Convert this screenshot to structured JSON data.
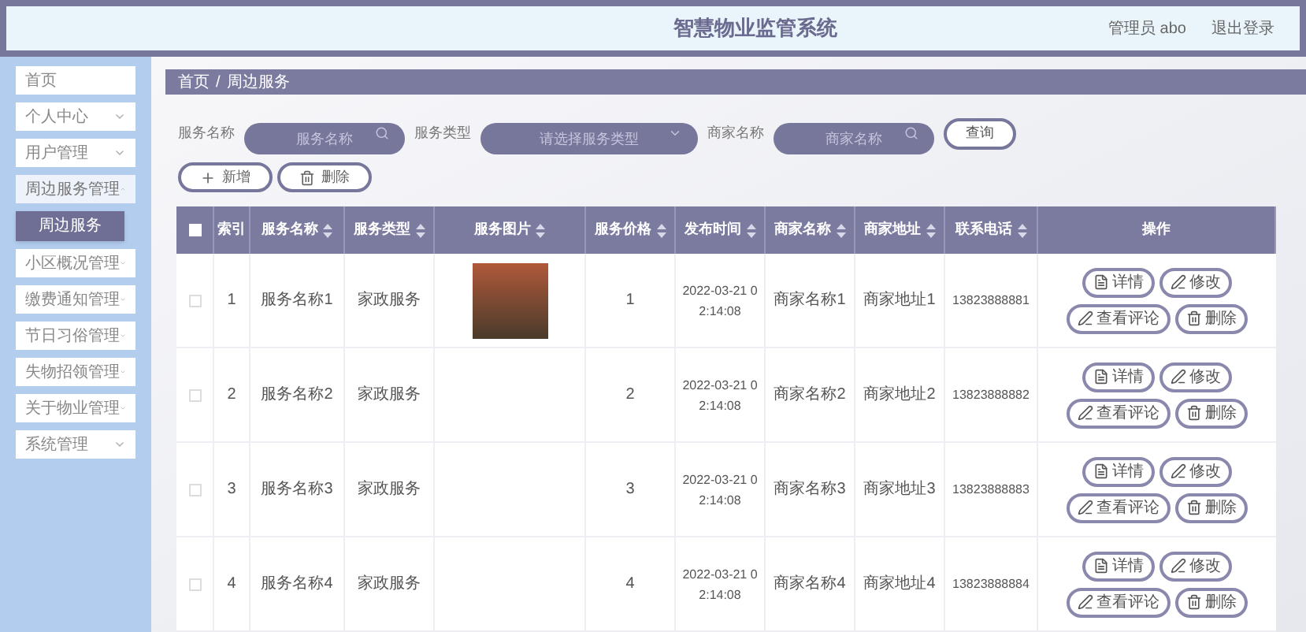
{
  "header": {
    "title": "智慧物业监管系统",
    "user": "管理员 abo",
    "logout": "退出登录"
  },
  "sidebar": {
    "items": [
      {
        "label": "首页",
        "kind": "link",
        "expanded": false
      },
      {
        "label": "个人中心",
        "kind": "menu",
        "expanded": false
      },
      {
        "label": "用户管理",
        "kind": "menu",
        "expanded": false
      },
      {
        "label": "周边服务管理",
        "kind": "menu",
        "expanded": true,
        "children": [
          {
            "label": "周边服务",
            "selected": true
          }
        ]
      },
      {
        "label": "小区概况管理",
        "kind": "menu",
        "expanded": false
      },
      {
        "label": "缴费通知管理",
        "kind": "menu",
        "expanded": false
      },
      {
        "label": "节日习俗管理",
        "kind": "menu",
        "expanded": false
      },
      {
        "label": "失物招领管理",
        "kind": "menu",
        "expanded": false
      },
      {
        "label": "关于物业管理",
        "kind": "menu",
        "expanded": false
      },
      {
        "label": "系统管理",
        "kind": "menu",
        "expanded": false
      }
    ]
  },
  "breadcrumb": [
    "首页",
    "周边服务"
  ],
  "breadcrumb_separator": "/",
  "filters": [
    {
      "label": "服务名称",
      "placeholder": "服务名称",
      "kind": "search"
    },
    {
      "label": "服务类型",
      "placeholder": "请选择服务类型",
      "kind": "select"
    },
    {
      "label": "商家名称",
      "placeholder": "商家名称",
      "kind": "search"
    }
  ],
  "query_button": "查询",
  "actions": [
    {
      "label": "新增",
      "kind": "add"
    },
    {
      "label": "删除",
      "kind": "delete"
    }
  ],
  "table": {
    "select_all_checked": false,
    "columns": [
      {
        "label": "索引",
        "sortable": false
      },
      {
        "label": "服务名称",
        "sortable": true
      },
      {
        "label": "服务类型",
        "sortable": true
      },
      {
        "label": "服务图片",
        "sortable": true
      },
      {
        "label": "服务价格",
        "sortable": true
      },
      {
        "label": "发布时间",
        "sortable": true
      },
      {
        "label": "商家名称",
        "sortable": true
      },
      {
        "label": "商家地址",
        "sortable": true
      },
      {
        "label": "联系电话",
        "sortable": true
      },
      {
        "label": "操作",
        "sortable": false
      }
    ],
    "rows": [
      {
        "checked": false,
        "index": "1",
        "name": "服务名称1",
        "type": "家政服务",
        "has_image": true,
        "price": "1",
        "time": "2022-03-21 02:14:08",
        "merchant": "商家名称1",
        "address": "商家地址1",
        "phone": "13823888881"
      },
      {
        "checked": false,
        "index": "2",
        "name": "服务名称2",
        "type": "家政服务",
        "has_image": false,
        "price": "2",
        "time": "2022-03-21 02:14:08",
        "merchant": "商家名称2",
        "address": "商家地址2",
        "phone": "13823888882"
      },
      {
        "checked": false,
        "index": "3",
        "name": "服务名称3",
        "type": "家政服务",
        "has_image": false,
        "price": "3",
        "time": "2022-03-21 02:14:08",
        "merchant": "商家名称3",
        "address": "商家地址3",
        "phone": "13823888883"
      },
      {
        "checked": false,
        "index": "4",
        "name": "服务名称4",
        "type": "家政服务",
        "has_image": false,
        "price": "4",
        "time": "2022-03-21 02:14:08",
        "merchant": "商家名称4",
        "address": "商家地址4",
        "phone": "13823888884"
      }
    ],
    "row_actions": [
      [
        {
          "label": "详情",
          "kind": "detail"
        },
        {
          "label": "修改",
          "kind": "edit"
        },
        {
          "label": "查看评论",
          "kind": "comment"
        },
        {
          "label": "删除",
          "kind": "delete"
        }
      ],
      [
        {
          "label": "详情",
          "kind": "detail"
        },
        {
          "label": "修改",
          "kind": "edit"
        },
        {
          "label": "查看评论",
          "kind": "comment"
        },
        {
          "label": "删除",
          "kind": "delete"
        }
      ],
      [
        {
          "label": "详情",
          "kind": "detail"
        },
        {
          "label": "修改",
          "kind": "edit"
        },
        {
          "label": "查看评论",
          "kind": "comment"
        },
        {
          "label": "删除",
          "kind": "delete"
        }
      ],
      [
        {
          "label": "详情",
          "kind": "detail"
        },
        {
          "label": "修改",
          "kind": "edit"
        },
        {
          "label": "查看评论",
          "kind": "comment"
        },
        {
          "label": "删除",
          "kind": "delete"
        }
      ]
    ]
  }
}
